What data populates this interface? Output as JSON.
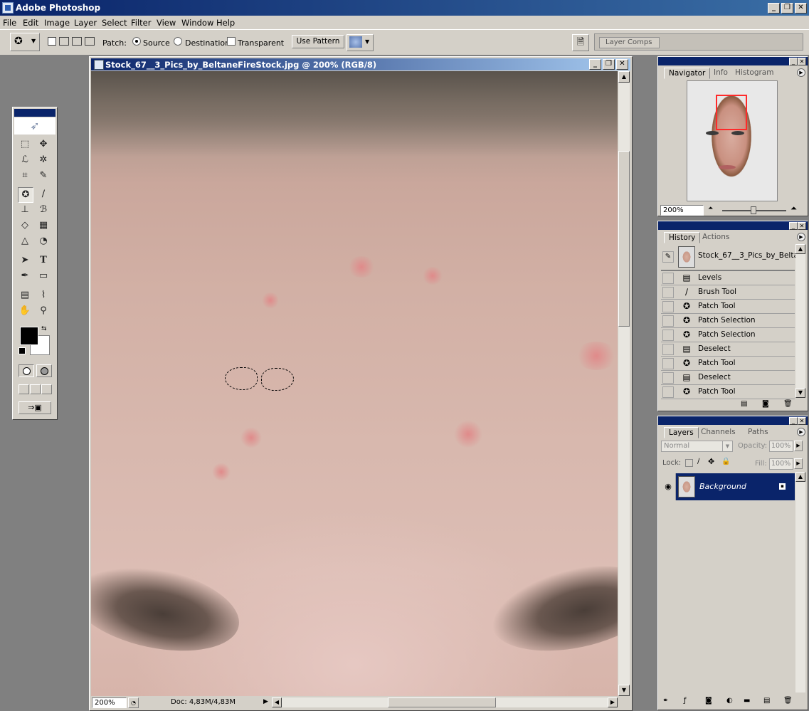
{
  "app": {
    "title": "Adobe Photoshop"
  },
  "menu": [
    "File",
    "Edit",
    "Image",
    "Layer",
    "Select",
    "Filter",
    "View",
    "Window",
    "Help"
  ],
  "options": {
    "patch_label": "Patch:",
    "source_label": "Source",
    "destination_label": "Destination",
    "transparent_label": "Transparent",
    "use_pattern_label": "Use Pattern",
    "source_selected": true,
    "layer_comps_label": "Layer Comps"
  },
  "document": {
    "title": "Stock_67__3_Pics_by_BeltaneFireStock.jpg @ 200% (RGB/8)",
    "zoom": "200%",
    "doc_size": "Doc: 4,83M/4,83M"
  },
  "navigator": {
    "tabs": [
      "Navigator",
      "Info",
      "Histogram"
    ],
    "zoom": "200%",
    "frame_color": "#ff2a2a"
  },
  "history": {
    "tabs": [
      "History",
      "Actions"
    ],
    "snapshot_label": "Stock_67__3_Pics_by_Belta...",
    "items": [
      {
        "label": "Levels",
        "icon": "document-icon"
      },
      {
        "label": "Brush Tool",
        "icon": "brush-icon"
      },
      {
        "label": "Patch Tool",
        "icon": "patch-icon"
      },
      {
        "label": "Patch Selection",
        "icon": "patch-icon"
      },
      {
        "label": "Patch Selection",
        "icon": "patch-icon"
      },
      {
        "label": "Deselect",
        "icon": "document-icon"
      },
      {
        "label": "Patch Tool",
        "icon": "patch-icon"
      },
      {
        "label": "Deselect",
        "icon": "document-icon"
      },
      {
        "label": "Patch Tool",
        "icon": "patch-icon"
      }
    ]
  },
  "layers": {
    "tabs": [
      "Layers",
      "Channels",
      "Paths"
    ],
    "blend_mode": "Normal",
    "opacity_label": "Opacity:",
    "opacity": "100%",
    "lock_label": "Lock:",
    "fill_label": "Fill:",
    "fill": "100%",
    "items": [
      {
        "name": "Background",
        "visible": true,
        "selected": true
      }
    ]
  }
}
